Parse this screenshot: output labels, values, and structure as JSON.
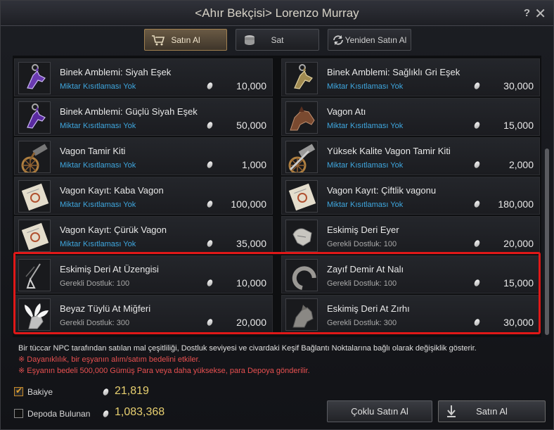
{
  "window": {
    "title": "<Ahır Bekçisi> Lorenzo Murray",
    "help": "?",
    "close": "✕"
  },
  "tabs": [
    {
      "label": "Satın Al",
      "icon": "cart-icon",
      "active": true
    },
    {
      "label": "Sat",
      "icon": "coin-stack-icon",
      "active": false
    },
    {
      "label": "Yeniden Satın Al",
      "icon": "refresh-icon",
      "active": false
    }
  ],
  "items": [
    {
      "name": "Binek Amblemi: Siyah Eşek",
      "sub": "Miktar Kısıtlaması Yok",
      "price": "10,000",
      "icon": "donkey-emblem-icon"
    },
    {
      "name": "Binek Amblemi: Sağlıklı Gri Eşek",
      "sub": "Miktar Kısıtlaması Yok",
      "price": "30,000",
      "icon": "donkey-emblem-icon"
    },
    {
      "name": "Binek Amblemi: Güçlü Siyah Eşek",
      "sub": "Miktar Kısıtlaması Yok",
      "price": "50,000",
      "icon": "donkey-emblem-icon"
    },
    {
      "name": "Vagon Atı",
      "sub": "Miktar Kısıtlaması Yok",
      "price": "15,000",
      "icon": "horse-head-icon"
    },
    {
      "name": "Vagon Tamir Kiti",
      "sub": "Miktar Kısıtlaması Yok",
      "price": "1,000",
      "icon": "repair-kit-icon"
    },
    {
      "name": "Yüksek Kalite Vagon Tamir Kiti",
      "sub": "Miktar Kısıtlaması Yok",
      "price": "2,000",
      "icon": "repair-kit-icon"
    },
    {
      "name": "Vagon Kayıt: Kaba Vagon",
      "sub": "Miktar Kısıtlaması Yok",
      "price": "100,000",
      "icon": "scroll-icon"
    },
    {
      "name": "Vagon Kayıt: Çiftlik vagonu",
      "sub": "Miktar Kısıtlaması Yok",
      "price": "180,000",
      "icon": "scroll-icon"
    },
    {
      "name": "Vagon Kayıt: Çürük Vagon",
      "sub": "Miktar Kısıtlaması Yok",
      "price": "35,000",
      "icon": "scroll-icon"
    },
    {
      "name": "Eskimiş Deri Eyer",
      "sub": "Gerekli Dostluk:",
      "level": "100",
      "price": "20,000",
      "icon": "saddle-icon"
    },
    {
      "name": "Eskimiş Deri At Üzengisi",
      "sub": "Gerekli Dostluk:",
      "level": "100",
      "price": "10,000",
      "icon": "stirrup-icon"
    },
    {
      "name": "Zayıf Demir At Nalı",
      "sub": "Gerekli Dostluk:",
      "level": "100",
      "price": "15,000",
      "icon": "horseshoe-icon"
    },
    {
      "name": "Beyaz Tüylü At Miğferi",
      "sub": "Gerekli Dostluk:",
      "level": "300",
      "price": "20,000",
      "icon": "feather-helmet-icon"
    },
    {
      "name": "Eskimiş Deri At Zırhı",
      "sub": "Gerekli Dostluk:",
      "level": "300",
      "price": "30,000",
      "icon": "horse-armor-icon"
    }
  ],
  "notes": [
    "Bir tüccar NPC tarafından satılan mal çeşitliliği, Dostluk seviyesi ve civardaki Keşif Bağlantı Noktalarına bağlı olarak değişiklik gösterir.",
    "※ Dayanıklılık, bir eşyanın alım/satım bedelini etkiler.",
    "※ Eşyanın bedeli 500,000 Gümüş Para veya daha yüksekse, para Depoya gönderilir."
  ],
  "footer": {
    "balance_label": "Bakiye",
    "balance": "21,819",
    "balance_checked": true,
    "storage_label": "Depoda  Bulunan",
    "storage": "1,083,368",
    "storage_checked": false,
    "bulk_buy": "Çoklu Satın Al",
    "buy": "Satın Al"
  },
  "colors": {
    "accent_blue": "#3fa8e0",
    "highlight_red": "#e01818",
    "warning_red": "#e85050",
    "silver_value": "#e8d070"
  }
}
